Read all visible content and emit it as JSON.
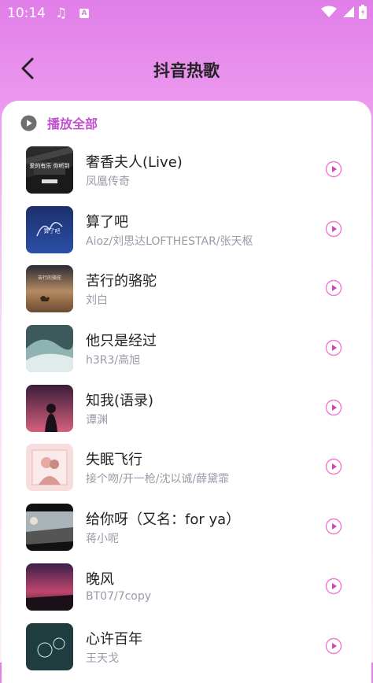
{
  "status_bar": {
    "time": "10:14",
    "note_icon": "♫",
    "a_icon": "A"
  },
  "header": {
    "title": "抖音热歌",
    "back_icon": "chevron-left-icon"
  },
  "play_all": {
    "label": "播放全部",
    "icon": "play-circle-icon"
  },
  "accent_color": "#c14fcf",
  "songs": [
    {
      "name": "奢香夫人(Live)",
      "artist": "凤凰传奇",
      "cover_text": "爱的有乐 你听到"
    },
    {
      "name": "算了吧",
      "artist": "Aioz/刘思达LOFTHESTAR/张天枢",
      "cover_text": "算了吧"
    },
    {
      "name": "苦行的骆驼",
      "artist": "刘白",
      "cover_text": "苦行的骆驼"
    },
    {
      "name": "他只是经过",
      "artist": "h3R3/高旭",
      "cover_text": ""
    },
    {
      "name": "知我(语录)",
      "artist": "谭渊",
      "cover_text": ""
    },
    {
      "name": "失眠飞行",
      "artist": "接个吻/开一枪/沈以诚/薛黛霏",
      "cover_text": ""
    },
    {
      "name": "给你呀（又名：for ya）",
      "artist": "蒋小呢",
      "cover_text": ""
    },
    {
      "name": "晚风",
      "artist": "BT07/7copy",
      "cover_text": ""
    },
    {
      "name": "心许百年",
      "artist": "王天戈",
      "cover_text": ""
    }
  ]
}
